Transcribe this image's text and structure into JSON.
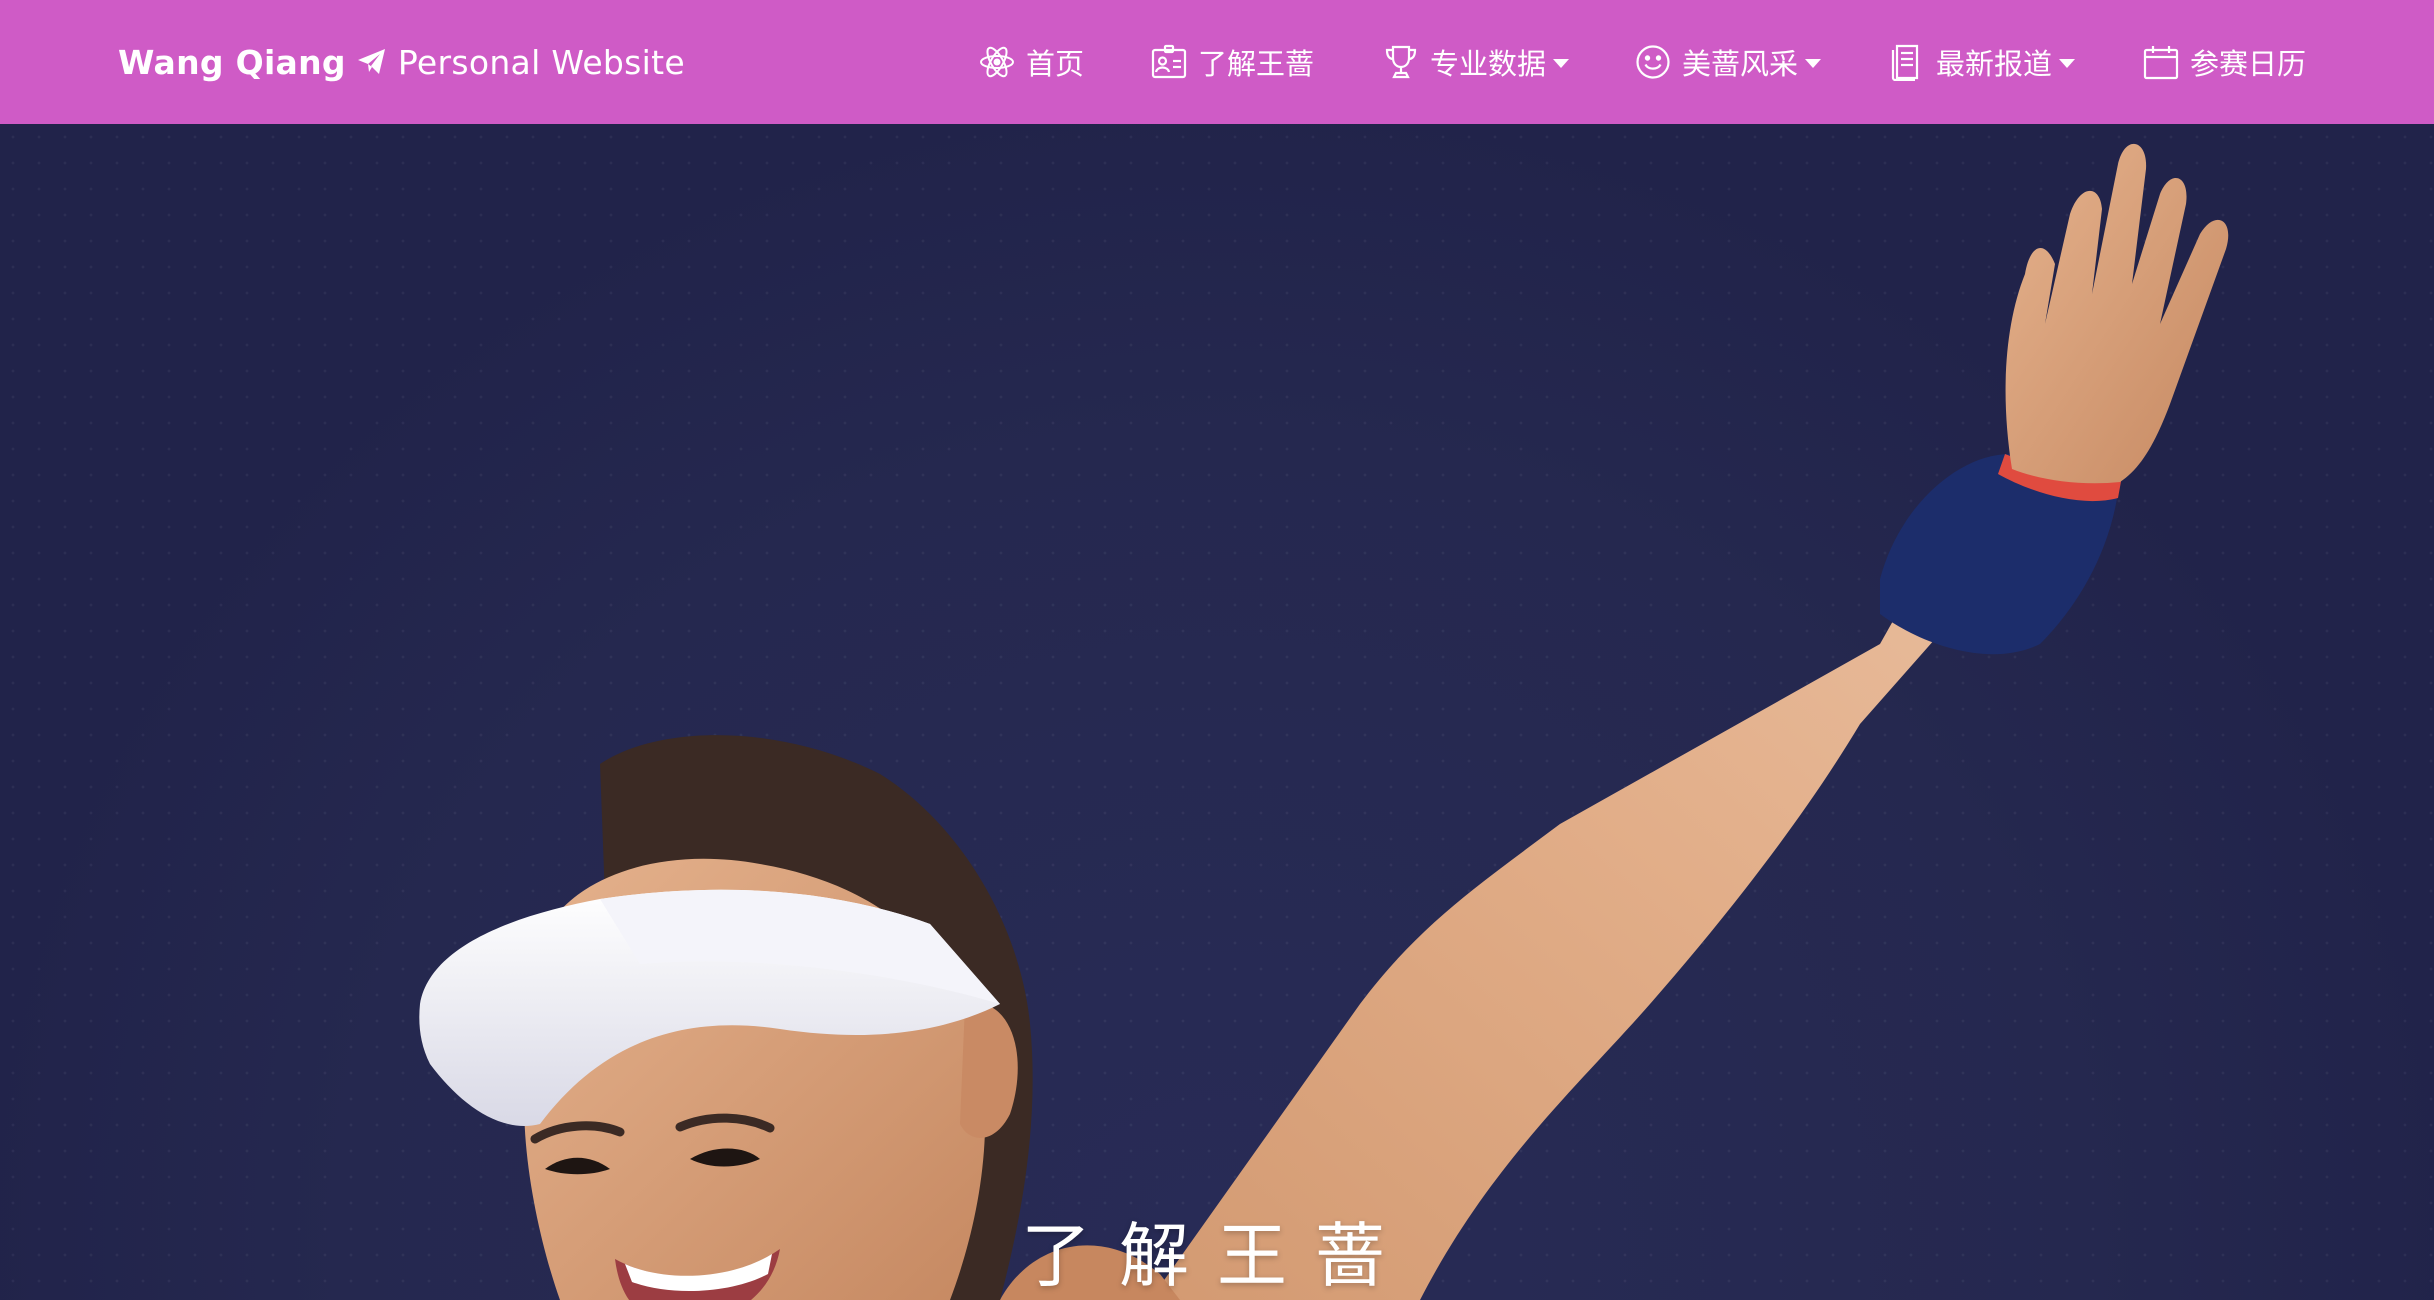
{
  "brand": {
    "name": "Wang Qiang",
    "subtitle": "Personal Website",
    "icon": "paper-plane-icon"
  },
  "nav": {
    "items": [
      {
        "label": "首页",
        "icon": "atom-icon",
        "dropdown": false
      },
      {
        "label": "了解王蔷",
        "icon": "id-card-icon",
        "dropdown": false
      },
      {
        "label": "专业数据",
        "icon": "trophy-icon",
        "dropdown": true
      },
      {
        "label": "美蔷风采",
        "icon": "smile-icon",
        "dropdown": true
      },
      {
        "label": "最新报道",
        "icon": "document-icon",
        "dropdown": true
      },
      {
        "label": "参赛日历",
        "icon": "calendar-icon",
        "dropdown": false
      }
    ]
  },
  "hero": {
    "title": "了解王蔷",
    "image": "tennis-player-waving-photo"
  },
  "colors": {
    "navbar": "#cf5bc6",
    "hero_background": "#21234a",
    "text": "#ffffff"
  }
}
